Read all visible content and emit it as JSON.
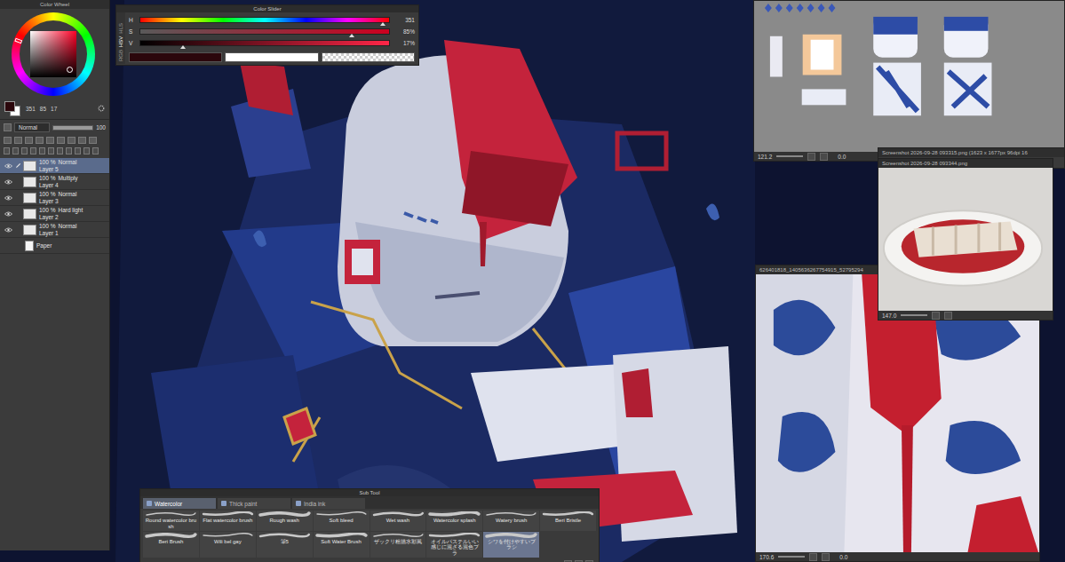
{
  "color_wheel": {
    "title": "Color Wheel",
    "hue": "351",
    "saturation": "85",
    "value": "17"
  },
  "color_slider": {
    "title": "Color Slider",
    "modes": [
      {
        "label": "RGB",
        "selected": false
      },
      {
        "label": "HSV",
        "selected": true
      },
      {
        "label": "HLS",
        "selected": false
      }
    ],
    "sliders": [
      {
        "name": "H",
        "kind": "hue",
        "level": 0.975,
        "reading": "351"
      },
      {
        "name": "S",
        "kind": "saturation",
        "level": 0.85,
        "reading": "85%"
      },
      {
        "name": "V",
        "kind": "value",
        "level": 0.17,
        "reading": "17%"
      }
    ]
  },
  "layer_palette": {
    "blend_mode": "Normal",
    "opacity": "100",
    "layers": [
      {
        "opacity": "100 %",
        "mode": "Normal",
        "name": "Layer 5",
        "kind": "raster",
        "visible": true,
        "selected": true
      },
      {
        "opacity": "100 %",
        "mode": "Multiply",
        "name": "Layer 4",
        "kind": "raster",
        "visible": true,
        "selected": false
      },
      {
        "opacity": "100 %",
        "mode": "Normal",
        "name": "Layer 3",
        "kind": "raster",
        "visible": true,
        "selected": false
      },
      {
        "opacity": "100 %",
        "mode": "Hard light",
        "name": "Layer 2",
        "kind": "raster",
        "visible": true,
        "selected": false
      },
      {
        "opacity": "100 %",
        "mode": "Normal",
        "name": "Layer 1",
        "kind": "raster",
        "visible": true,
        "selected": false
      },
      {
        "name": "Paper",
        "kind": "paper",
        "visible": false,
        "selected": false
      }
    ]
  },
  "references": [
    {
      "kind": "design-sheet",
      "zoom": "121.2",
      "angle": "0.0"
    },
    {
      "kind": "porcelain",
      "title": "626401818_1405636267754915_52795294",
      "zoom": "170.6",
      "angle": "0.0"
    },
    {
      "kind": "stacked",
      "title": "Screenshot 2026-09-28 093315.png (1623 x 1677px 96dpi 16"
    },
    {
      "kind": "plate",
      "title": "Screenshot 2026-09-28 093344.png",
      "zoom": "147.0"
    }
  ],
  "sub_tool": {
    "title": "Sub Tool",
    "tabs": [
      {
        "label": "Watercolor",
        "selected": true
      },
      {
        "label": "Thick paint",
        "selected": false
      },
      {
        "label": "India ink",
        "selected": false
      }
    ],
    "brushes": [
      {
        "name": "Round watercolor brush",
        "selected": false
      },
      {
        "name": "Flat watercolor brush",
        "selected": false
      },
      {
        "name": "Rough wash",
        "selected": false
      },
      {
        "name": "Soft bleed",
        "selected": false
      },
      {
        "name": "Wet wash",
        "selected": false
      },
      {
        "name": "Watercolor splash",
        "selected": false
      },
      {
        "name": "Watery brush",
        "selected": false
      },
      {
        "name": "Beri Bristle",
        "selected": false
      },
      {
        "name": "Beri Brush",
        "selected": false
      },
      {
        "name": "Wili bel gay",
        "selected": false
      },
      {
        "name": "筆5",
        "selected": false
      },
      {
        "name": "Soft Water Brush",
        "selected": false
      },
      {
        "name": "ザックリ粗描水彩風",
        "selected": false
      },
      {
        "name": "オイルパステルいい感じに混ざる混色ブラ",
        "selected": false
      },
      {
        "name": "シワを付けやすいブラシ",
        "selected": true
      }
    ]
  }
}
